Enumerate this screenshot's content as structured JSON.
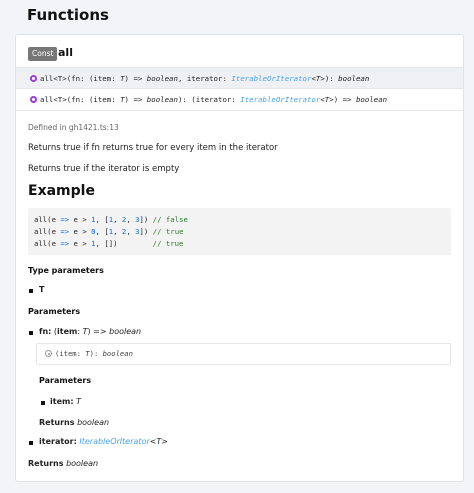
{
  "page_title": "Functions",
  "member": {
    "kind_badge": "Const",
    "name": "all"
  },
  "signatures": [
    {
      "prefix": "all<T>(fn: (item: ",
      "t1": "T",
      "mid1": ") => ",
      "ret1": "boolean",
      "mid2": ", iterator: ",
      "type_link": "IterableOrIterator",
      "gen_open": "<",
      "gen_t": "T",
      "gen_close": ">",
      "mid3": "): ",
      "ret2": "boolean"
    },
    {
      "prefix": "all<T>(fn: (item: ",
      "t1": "T",
      "mid1": ") => ",
      "ret1": "boolean",
      "mid2": "): (iterator: ",
      "type_link": "IterableOrIterator",
      "gen_open": "<",
      "gen_t": "T",
      "gen_close": ">",
      "mid3": ") => ",
      "ret2": "boolean"
    }
  ],
  "defined_in": "Defined in gh1421.ts:13",
  "description_1": "Returns true if fn returns true for every item in the iterator",
  "description_2": "Returns true if the iterator is empty",
  "example_heading": "Example",
  "code_lines": [
    {
      "a": "all(e ",
      "arrow": "=>",
      "b": " e > ",
      "n1": "1",
      "c": ", [",
      "n2": "1",
      "d": ", ",
      "n3": "2",
      "e": ", ",
      "n4": "3",
      "f": "])",
      "pad": " ",
      "comment": "// false"
    },
    {
      "a": "all(e ",
      "arrow": "=>",
      "b": " e > ",
      "n1": "0",
      "c": ", [",
      "n2": "1",
      "d": ", ",
      "n3": "2",
      "e": ", ",
      "n4": "3",
      "f": "])",
      "pad": " ",
      "comment": "// true"
    },
    {
      "a": "all(e ",
      "arrow": "=>",
      "b": " e > ",
      "n1": "1",
      "c": ", [",
      "n2": "",
      "d": "",
      "n3": "",
      "e": "",
      "n4": "",
      "f": "])",
      "pad": "        ",
      "comment": "// true"
    }
  ],
  "type_parameters_heading": "Type parameters",
  "type_param": "T",
  "parameters_heading": "Parameters",
  "param_fn": {
    "name": "fn:",
    "open": " (",
    "item": "item",
    "colon": ": ",
    "t": "T",
    "arrow": ") => ",
    "ret": "boolean"
  },
  "inner_sig": {
    "prefix": "(item: ",
    "t": "T",
    "mid": "): ",
    "ret": "boolean"
  },
  "inner_parameters_heading": "Parameters",
  "inner_param": {
    "name": "item:",
    "type": "T"
  },
  "inner_returns_label": "Returns",
  "inner_returns_type": "boolean",
  "param_iterator": {
    "name": "iterator:",
    "type_link": "IterableOrIterator",
    "gen": "<T>"
  },
  "returns_label": "Returns",
  "returns_type": "boolean"
}
